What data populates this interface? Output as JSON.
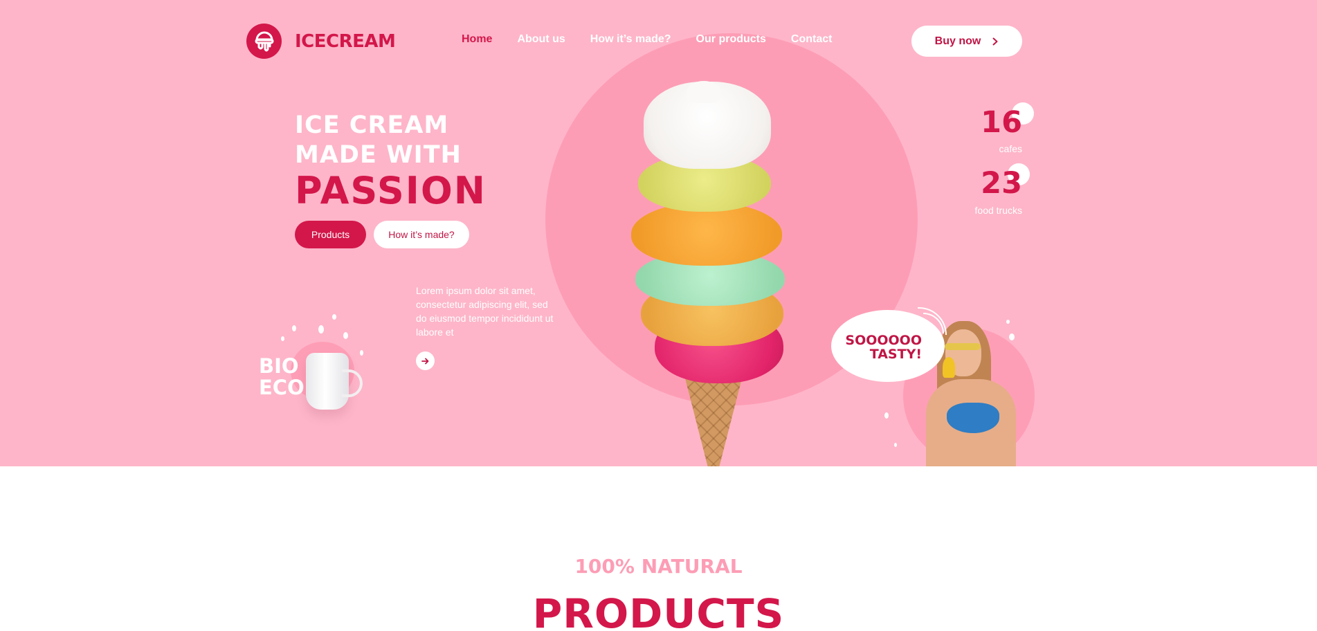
{
  "brand": {
    "name": "ICECREAM",
    "logo_icon": "ice-cream-scoop-icon",
    "primary_color": "#d3174a",
    "hero_bg": "#feb5c9"
  },
  "nav": {
    "items": [
      {
        "label": "Home",
        "active": true
      },
      {
        "label": "About us"
      },
      {
        "label": "How it’s made?"
      },
      {
        "label": "Our products"
      },
      {
        "label": "Contact"
      }
    ],
    "buy_button": {
      "label": "Buy now",
      "icon": "chevron-right-icon"
    }
  },
  "hero": {
    "headline_line1": "ICE CREAM",
    "headline_line2": "MADE WITH",
    "headline_line3": "PASSION",
    "primary_cta": "Products",
    "secondary_cta": "How it’s made?",
    "description": "Lorem ipsum dolor sit amet, consectetur adipiscing elit, sed do eiusmod tempor incididunt ut labore et",
    "arrow_icon": "arrow-right-icon",
    "badge_text": "BIO ECO",
    "bubble_text": "SOOOOOO\nTASTY!"
  },
  "stats": [
    {
      "value": "16",
      "label": "cafes"
    },
    {
      "value": "23",
      "label": "food trucks"
    }
  ],
  "products_section": {
    "subtitle": "100% NATURAL",
    "title": "PRODUCTS"
  }
}
